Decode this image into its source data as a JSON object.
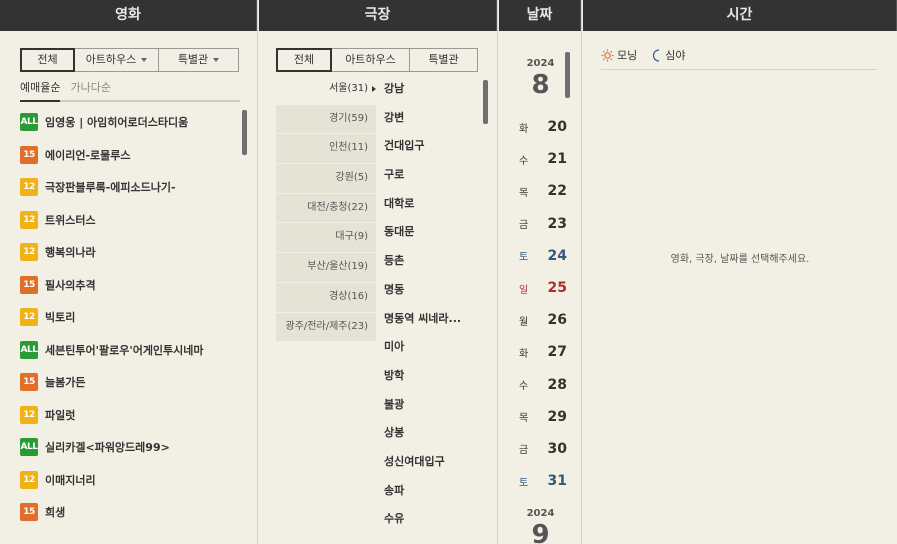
{
  "columns": {
    "movie": "영화",
    "theater": "극장",
    "date": "날짜",
    "time": "시간"
  },
  "movie_panel": {
    "tabs": [
      {
        "label": "전체",
        "active": true,
        "dropdown": false
      },
      {
        "label": "아트하우스",
        "active": false,
        "dropdown": true
      },
      {
        "label": "특별관",
        "active": false,
        "dropdown": true
      }
    ],
    "sort": [
      {
        "label": "예매율순",
        "active": true
      },
      {
        "label": "가나다순",
        "active": false
      }
    ],
    "movies": [
      {
        "grade": "ALL",
        "title": "임영웅 | 아임히어로더스타디움"
      },
      {
        "grade": "15",
        "title": "에이리언-로물루스"
      },
      {
        "grade": "12",
        "title": "극장판블루록-에피소드나기-"
      },
      {
        "grade": "12",
        "title": "트위스터스"
      },
      {
        "grade": "12",
        "title": "행복의나라"
      },
      {
        "grade": "15",
        "title": "필사의추격"
      },
      {
        "grade": "12",
        "title": "빅토리"
      },
      {
        "grade": "ALL",
        "title": "세븐틴투어'팔로우'어게인투시네마"
      },
      {
        "grade": "15",
        "title": "늘봄가든"
      },
      {
        "grade": "12",
        "title": "파일럿"
      },
      {
        "grade": "ALL",
        "title": "실리카겔<파워앙드레99>"
      },
      {
        "grade": "12",
        "title": "이매지너리"
      },
      {
        "grade": "15",
        "title": "희생"
      }
    ]
  },
  "theater_panel": {
    "tabs": [
      {
        "label": "전체",
        "active": true,
        "dropdown": false
      },
      {
        "label": "아트하우스",
        "active": false,
        "dropdown": false
      },
      {
        "label": "특별관",
        "active": false,
        "dropdown": false
      }
    ],
    "regions": [
      {
        "label": "서울(31)",
        "active": true
      },
      {
        "label": "경기(59)",
        "active": false
      },
      {
        "label": "인천(11)",
        "active": false
      },
      {
        "label": "강원(5)",
        "active": false
      },
      {
        "label": "대전/충청(22)",
        "active": false
      },
      {
        "label": "대구(9)",
        "active": false
      },
      {
        "label": "부산/울산(19)",
        "active": false
      },
      {
        "label": "경상(16)",
        "active": false
      },
      {
        "label": "광주/전라/제주(23)",
        "active": false
      }
    ],
    "theaters": [
      "강남",
      "강변",
      "건대입구",
      "구로",
      "대학로",
      "동대문",
      "등촌",
      "명동",
      "명동역 씨네라...",
      "미아",
      "방학",
      "불광",
      "상봉",
      "성신여대입구",
      "송파",
      "수유"
    ]
  },
  "date_panel": {
    "groups": [
      {
        "year": "2024",
        "month": "8"
      },
      {
        "year": "2024",
        "month": "9"
      }
    ],
    "dates": [
      {
        "dow": "화",
        "day": "20",
        "type": "weekday"
      },
      {
        "dow": "수",
        "day": "21",
        "type": "weekday"
      },
      {
        "dow": "목",
        "day": "22",
        "type": "weekday"
      },
      {
        "dow": "금",
        "day": "23",
        "type": "weekday"
      },
      {
        "dow": "토",
        "day": "24",
        "type": "sat"
      },
      {
        "dow": "일",
        "day": "25",
        "type": "sun"
      },
      {
        "dow": "월",
        "day": "26",
        "type": "weekday"
      },
      {
        "dow": "화",
        "day": "27",
        "type": "weekday"
      },
      {
        "dow": "수",
        "day": "28",
        "type": "weekday"
      },
      {
        "dow": "목",
        "day": "29",
        "type": "weekday"
      },
      {
        "dow": "금",
        "day": "30",
        "type": "weekday"
      },
      {
        "dow": "토",
        "day": "31",
        "type": "sat"
      }
    ]
  },
  "time_panel": {
    "legend": [
      {
        "icon": "sun-icon",
        "label": "모닝",
        "color": "#e0703a"
      },
      {
        "icon": "moon-icon",
        "label": "심야",
        "color": "#3a5a8a"
      }
    ],
    "placeholder": "영화, 극장, 날짜를 선택해주세요."
  }
}
